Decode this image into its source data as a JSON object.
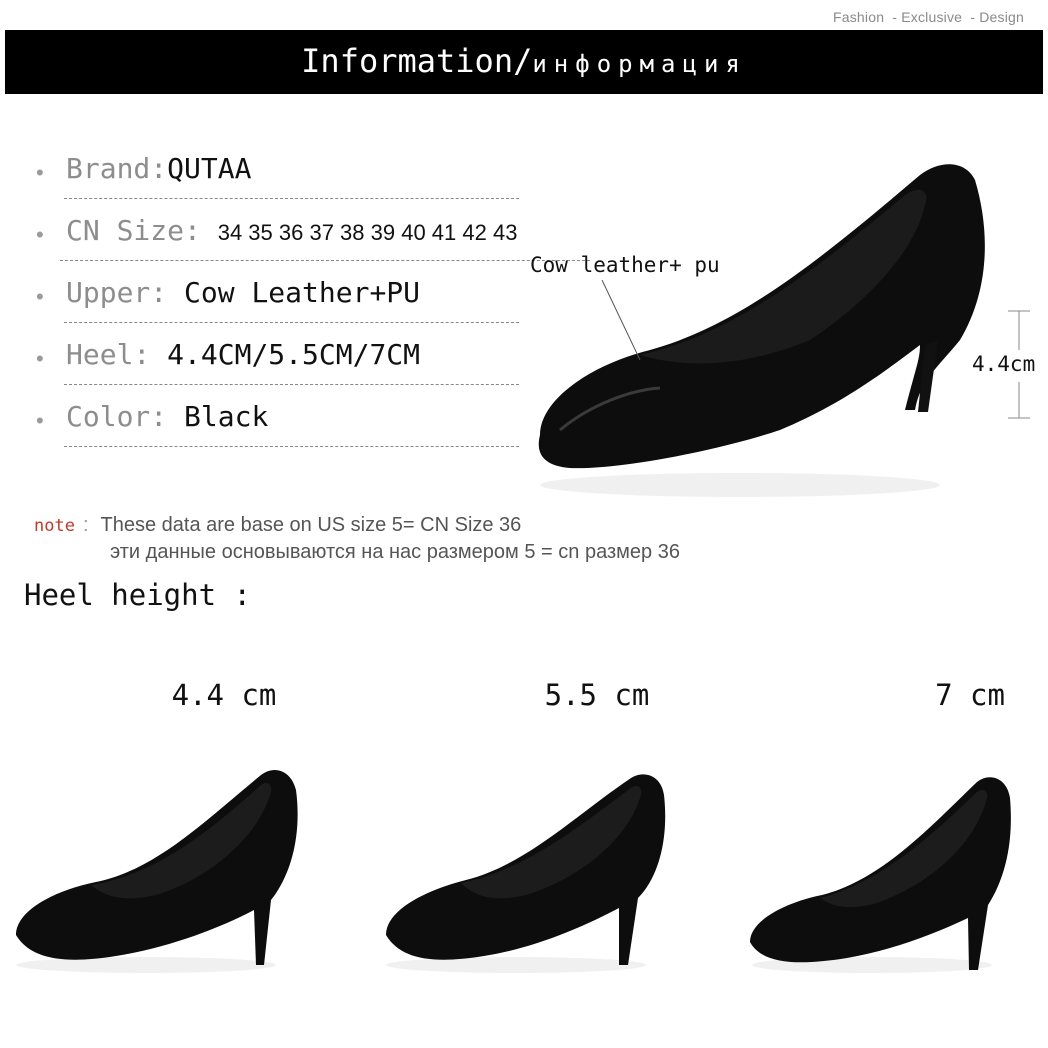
{
  "tagline": [
    "Fashion",
    "- Exclusive",
    "- Design"
  ],
  "banner": {
    "title_en": "Information/",
    "title_ru": "информация"
  },
  "specs": [
    {
      "label": "Brand:",
      "value": "QUTAA"
    },
    {
      "label": "CN Size:",
      "value": "34 35 36 37 38 39 40 41 42 43"
    },
    {
      "label": "Upper:",
      "value": " Cow Leather+PU"
    },
    {
      "label": "Heel:",
      "value": " 4.4CM/5.5CM/7CM"
    },
    {
      "label": "Color:",
      "value": " Black"
    }
  ],
  "callout": "Cow leather+ pu",
  "dimension_label": "4.4cm",
  "note": {
    "key": "note",
    "sep": ":",
    "en": "These data are base on US size 5= CN Size 36",
    "ru": "эти данные основываются на нас размером 5 = cn размер 36"
  },
  "heel_height_title": "Heel height :",
  "heel_sizes": [
    "4.4 cm",
    "5.5 cm",
    "7 cm"
  ],
  "colors": {
    "banner": "#000000",
    "note_key": "#c0392b",
    "label_gray": "#8d8d8d"
  }
}
